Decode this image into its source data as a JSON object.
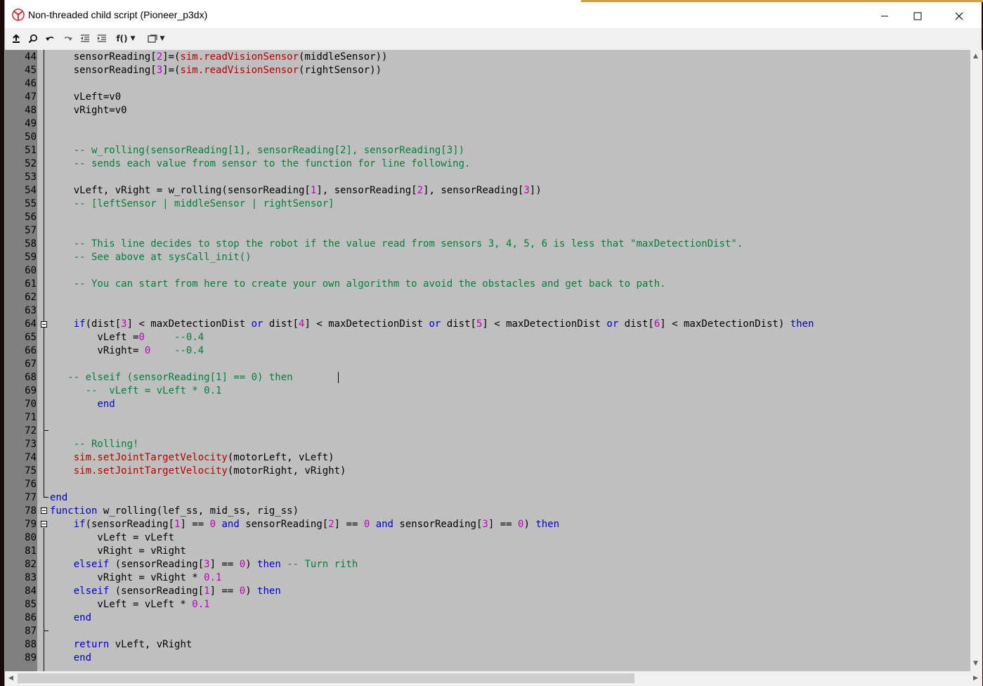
{
  "window": {
    "title": "Non-threaded child script (Pioneer_p3dx)"
  },
  "toolbar": {
    "function_menu": "f()"
  },
  "editor": {
    "lines": [
      {
        "n": "44",
        "code": "    sensorReading[2]=(sim.readVisionSensor(middleSensor))"
      },
      {
        "n": "45",
        "code": "    sensorReading[3]=(sim.readVisionSensor(rightSensor))"
      },
      {
        "n": "46",
        "code": ""
      },
      {
        "n": "47",
        "code": "    vLeft=v0"
      },
      {
        "n": "48",
        "code": "    vRight=v0"
      },
      {
        "n": "49",
        "code": ""
      },
      {
        "n": "50",
        "code": ""
      },
      {
        "n": "51",
        "code": "    -- w_rolling(sensorReading[1], sensorReading[2], sensorReading[3])"
      },
      {
        "n": "52",
        "code": "    -- sends each value from sensor to the function for line following."
      },
      {
        "n": "53",
        "code": ""
      },
      {
        "n": "54",
        "code": "    vLeft, vRight = w_rolling(sensorReading[1], sensorReading[2], sensorReading[3])"
      },
      {
        "n": "55",
        "code": "    -- [leftSensor | middleSensor | rightSensor]"
      },
      {
        "n": "56",
        "code": ""
      },
      {
        "n": "57",
        "code": ""
      },
      {
        "n": "58",
        "code": "    -- This line decides to stop the robot if the value read from sensors 3, 4, 5, 6 is less that \"maxDetectionDist\"."
      },
      {
        "n": "59",
        "code": "    -- See above at sysCall_init()"
      },
      {
        "n": "60",
        "code": ""
      },
      {
        "n": "61",
        "code": "    -- You can start from here to create your own algorithm to avoid the obstacles and get back to path."
      },
      {
        "n": "62",
        "code": ""
      },
      {
        "n": "63",
        "code": ""
      },
      {
        "n": "64",
        "code": "    if(dist[3] < maxDetectionDist or dist[4] < maxDetectionDist or dist[5] < maxDetectionDist or dist[6] < maxDetectionDist) then"
      },
      {
        "n": "65",
        "code": "        vLeft =0     --0.4"
      },
      {
        "n": "66",
        "code": "        vRight= 0    --0.4"
      },
      {
        "n": "67",
        "code": ""
      },
      {
        "n": "68",
        "code": "   -- elseif (sensorReading[1] == 0) then"
      },
      {
        "n": "69",
        "code": "      --  vLeft = vLeft * 0.1"
      },
      {
        "n": "70",
        "code": "        end"
      },
      {
        "n": "71",
        "code": ""
      },
      {
        "n": "72",
        "code": ""
      },
      {
        "n": "73",
        "code": "    -- Rolling!"
      },
      {
        "n": "74",
        "code": "    sim.setJointTargetVelocity(motorLeft, vLeft)"
      },
      {
        "n": "75",
        "code": "    sim.setJointTargetVelocity(motorRight, vRight)"
      },
      {
        "n": "76",
        "code": ""
      },
      {
        "n": "77",
        "code": "end"
      },
      {
        "n": "78",
        "code": "function w_rolling(lef_ss, mid_ss, rig_ss)"
      },
      {
        "n": "79",
        "code": "    if(sensorReading[1] == 0 and sensorReading[2] == 0 and sensorReading[3] == 0) then"
      },
      {
        "n": "80",
        "code": "        vLeft = vLeft"
      },
      {
        "n": "81",
        "code": "        vRight = vRight"
      },
      {
        "n": "82",
        "code": "    elseif (sensorReading[3] == 0) then -- Turn rith"
      },
      {
        "n": "83",
        "code": "        vRight = vRight * 0.1"
      },
      {
        "n": "84",
        "code": "    elseif (sensorReading[1] == 0) then"
      },
      {
        "n": "85",
        "code": "        vLeft = vLeft * 0.1"
      },
      {
        "n": "86",
        "code": "    end"
      },
      {
        "n": "87",
        "code": ""
      },
      {
        "n": "88",
        "code": "    return vLeft, vRight"
      },
      {
        "n": "89",
        "code": "    end"
      }
    ]
  },
  "colors": {
    "editor_bg": "#bfbfbf",
    "gutter_bg": "#808080",
    "keyword": "#0000cc",
    "comment": "#00803a",
    "sim_function": "#b40000",
    "number": "#c000c0"
  }
}
